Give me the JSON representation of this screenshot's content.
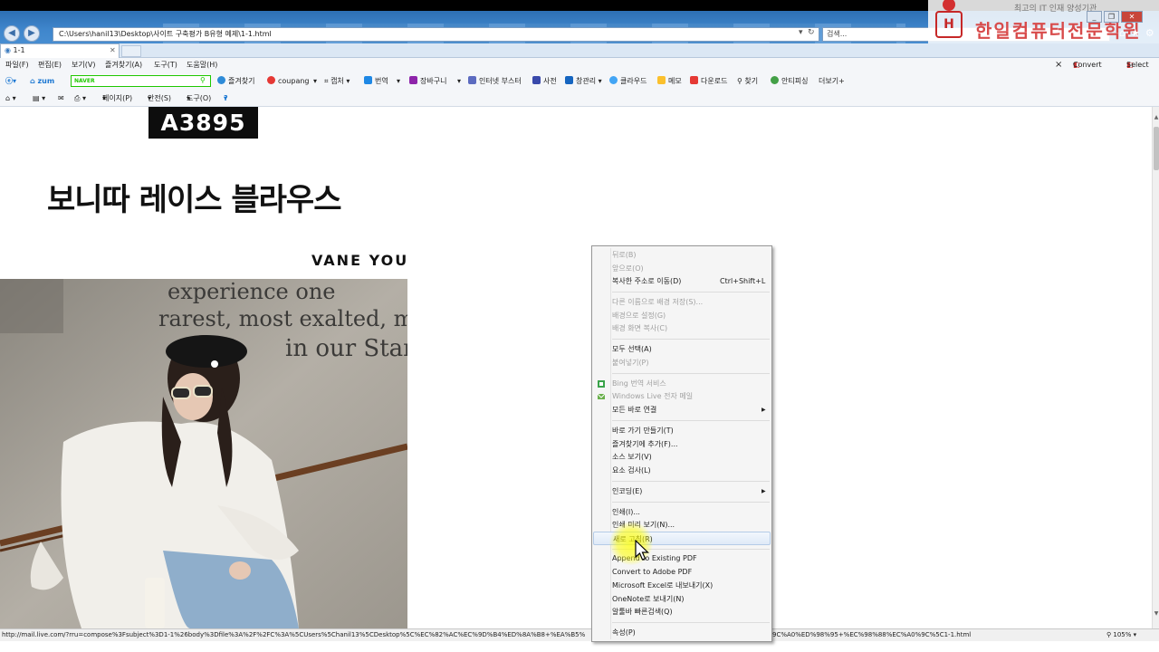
{
  "window": {
    "address": "C:\\Users\\hanil13\\Desktop\\사이트 구축평가 B유형 예제\\1-1.html",
    "search_placeholder": "검색...",
    "tab_title": "1-1",
    "brand_text": "한일컴퓨터전문학원",
    "brand_sub": "최고의 IT 인재 양성기관"
  },
  "menubar": {
    "items": [
      "파일(F)",
      "편집(E)",
      "보기(V)",
      "즐겨찾기(A)",
      "도구(T)",
      "도움말(H)"
    ],
    "close": "×",
    "convert": "Convert",
    "select": "Select"
  },
  "favbar": {
    "zum": "zum",
    "naver_label": "NAVER",
    "items": [
      "즐겨찾기",
      "coupang",
      "캡처",
      "번역",
      "장바구니",
      "인터넷 부스터",
      "사전",
      "창관리",
      "클라우드",
      "메모",
      "다운로드",
      "찾기",
      "안티피싱",
      "더보기+"
    ]
  },
  "cmdbar": {
    "page": "페이지(P)",
    "safety": "안전(S)",
    "tools": "도구(O)",
    "help": "?"
  },
  "content": {
    "product_code": "A3895",
    "product_title": "보니따 레이스 블라우스",
    "brand_wordmark": "VANE YOU",
    "wall_line1": "experience one",
    "wall_line2": "rarest, most exalted, mo",
    "wall_line3": "in our Star"
  },
  "context_menu": {
    "items": [
      {
        "label": "뒤로(B)",
        "disabled": true
      },
      {
        "label": "앞으로(O)",
        "disabled": true
      },
      {
        "label": "복사한 주소로 이동(D)",
        "shortcut": "Ctrl+Shift+L",
        "disabled": false
      },
      {
        "label": "다른 이름으로 배경 저장(S)...",
        "disabled": true
      },
      {
        "label": "배경으로 설정(G)",
        "disabled": true
      },
      {
        "label": "배경 화면 복사(C)",
        "disabled": true
      },
      {
        "label": "모두 선택(A)",
        "disabled": false
      },
      {
        "label": "붙여넣기(P)",
        "disabled": true
      },
      {
        "label": "Bing 번역 서비스",
        "disabled": true
      },
      {
        "label": "Windows Live 전자 메일",
        "disabled": true
      },
      {
        "label": "모든 바로 연결",
        "disabled": false
      },
      {
        "label": "바로 가기 만들기(T)",
        "disabled": false
      },
      {
        "label": "즐겨찾기에 추가(F)...",
        "disabled": false
      },
      {
        "label": "소스 보기(V)",
        "disabled": false
      },
      {
        "label": "요소 검사(L)",
        "disabled": false
      },
      {
        "label": "인코딩(E)",
        "disabled": false
      },
      {
        "label": "인쇄(I)...",
        "disabled": false
      },
      {
        "label": "인쇄 미리 보기(N)...",
        "disabled": false
      },
      {
        "label": "새로 고침(R)",
        "disabled": false
      },
      {
        "label": "Append to Existing PDF",
        "disabled": false
      },
      {
        "label": "Convert to Adobe PDF",
        "disabled": false
      },
      {
        "label": "Microsoft Excel로 내보내기(X)",
        "disabled": false
      },
      {
        "label": "OneNote로 보내기(N)",
        "disabled": false
      },
      {
        "label": "알툴바 빠른검색(Q)",
        "disabled": false
      },
      {
        "label": "속성(P)",
        "disabled": false
      }
    ]
  },
  "status": {
    "url": "http://mail.live.com/?rru=compose%3Fsubject%3D1-1%26body%3Dfile%3A%2F%2FC%3A%5CUsers%5Chanil13%5CDesktop%5C%EC%82%AC%EC%9D%B4%ED%8A%B8+%EA%B5%",
    "url_tail": "9C%A0%ED%98%95+%EC%98%88%EC%A0%9C%5C1-1.html",
    "zoom": "105%"
  },
  "colors": {
    "titlebar": "#3f86cc",
    "badge_bg": "#0d0d0d",
    "naver_green": "#1ec800",
    "highlight_yellow": "#ffff00",
    "brand_red": "#d84b4b"
  }
}
